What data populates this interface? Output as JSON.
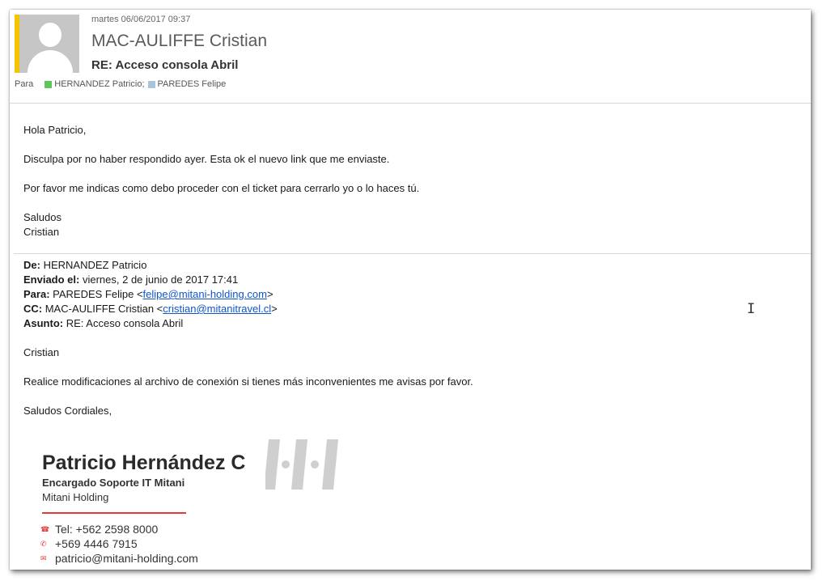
{
  "header": {
    "date": "martes 06/06/2017 09:37",
    "sender": "MAC-AULIFFE Cristian",
    "subject": "RE: Acceso consola Abril",
    "to_label": "Para",
    "recipients": [
      {
        "name": "HERNANDEZ Patricio",
        "color": "#5cc85c",
        "separator": ";"
      },
      {
        "name": "PAREDES Felipe",
        "color": "#a9c4dc",
        "separator": ""
      }
    ]
  },
  "reply": {
    "greeting": "Hola Patricio,",
    "p1": "Disculpa por no haber respondido ayer. Esta ok el nuevo link que me enviaste.",
    "p2": "Por favor me indicas como debo proceder con el ticket para cerrarlo yo o lo haces tú.",
    "closing": "Saludos",
    "signoff": "Cristian"
  },
  "quoted": {
    "from_label": "De:",
    "from": " HERNANDEZ Patricio",
    "sent_label": "Enviado el:",
    "sent": " viernes, 2 de junio de 2017 17:41",
    "to_label": "Para:",
    "to_name": " PAREDES Felipe <",
    "to_email": "felipe@mitani-holding.com",
    "to_end": ">",
    "cc_label": "CC:",
    "cc_name": " MAC-AULIFFE Cristian <",
    "cc_email": "cristian@mitanitravel.cl",
    "cc_end": ">",
    "subject_label": "Asunto:",
    "subject": " RE: Acceso consola Abril",
    "greeting": "Cristian",
    "body": "Realice modificaciones al archivo de conexión si tienes más inconvenientes me avisas por favor.",
    "closing": "Saludos Cordiales,"
  },
  "signature": {
    "name": "Patricio Hernández C",
    "role": "Encargado Soporte IT Mitani",
    "company": "Mitani Holding",
    "tel": "Tel: +562 2598 8000",
    "mobile": "+569  4446 7915",
    "email": "patricio@mitani-holding.com",
    "icons": [
      "phone-icon",
      "mobile-icon",
      "envelope-icon"
    ],
    "accent_color": "#e53935"
  }
}
